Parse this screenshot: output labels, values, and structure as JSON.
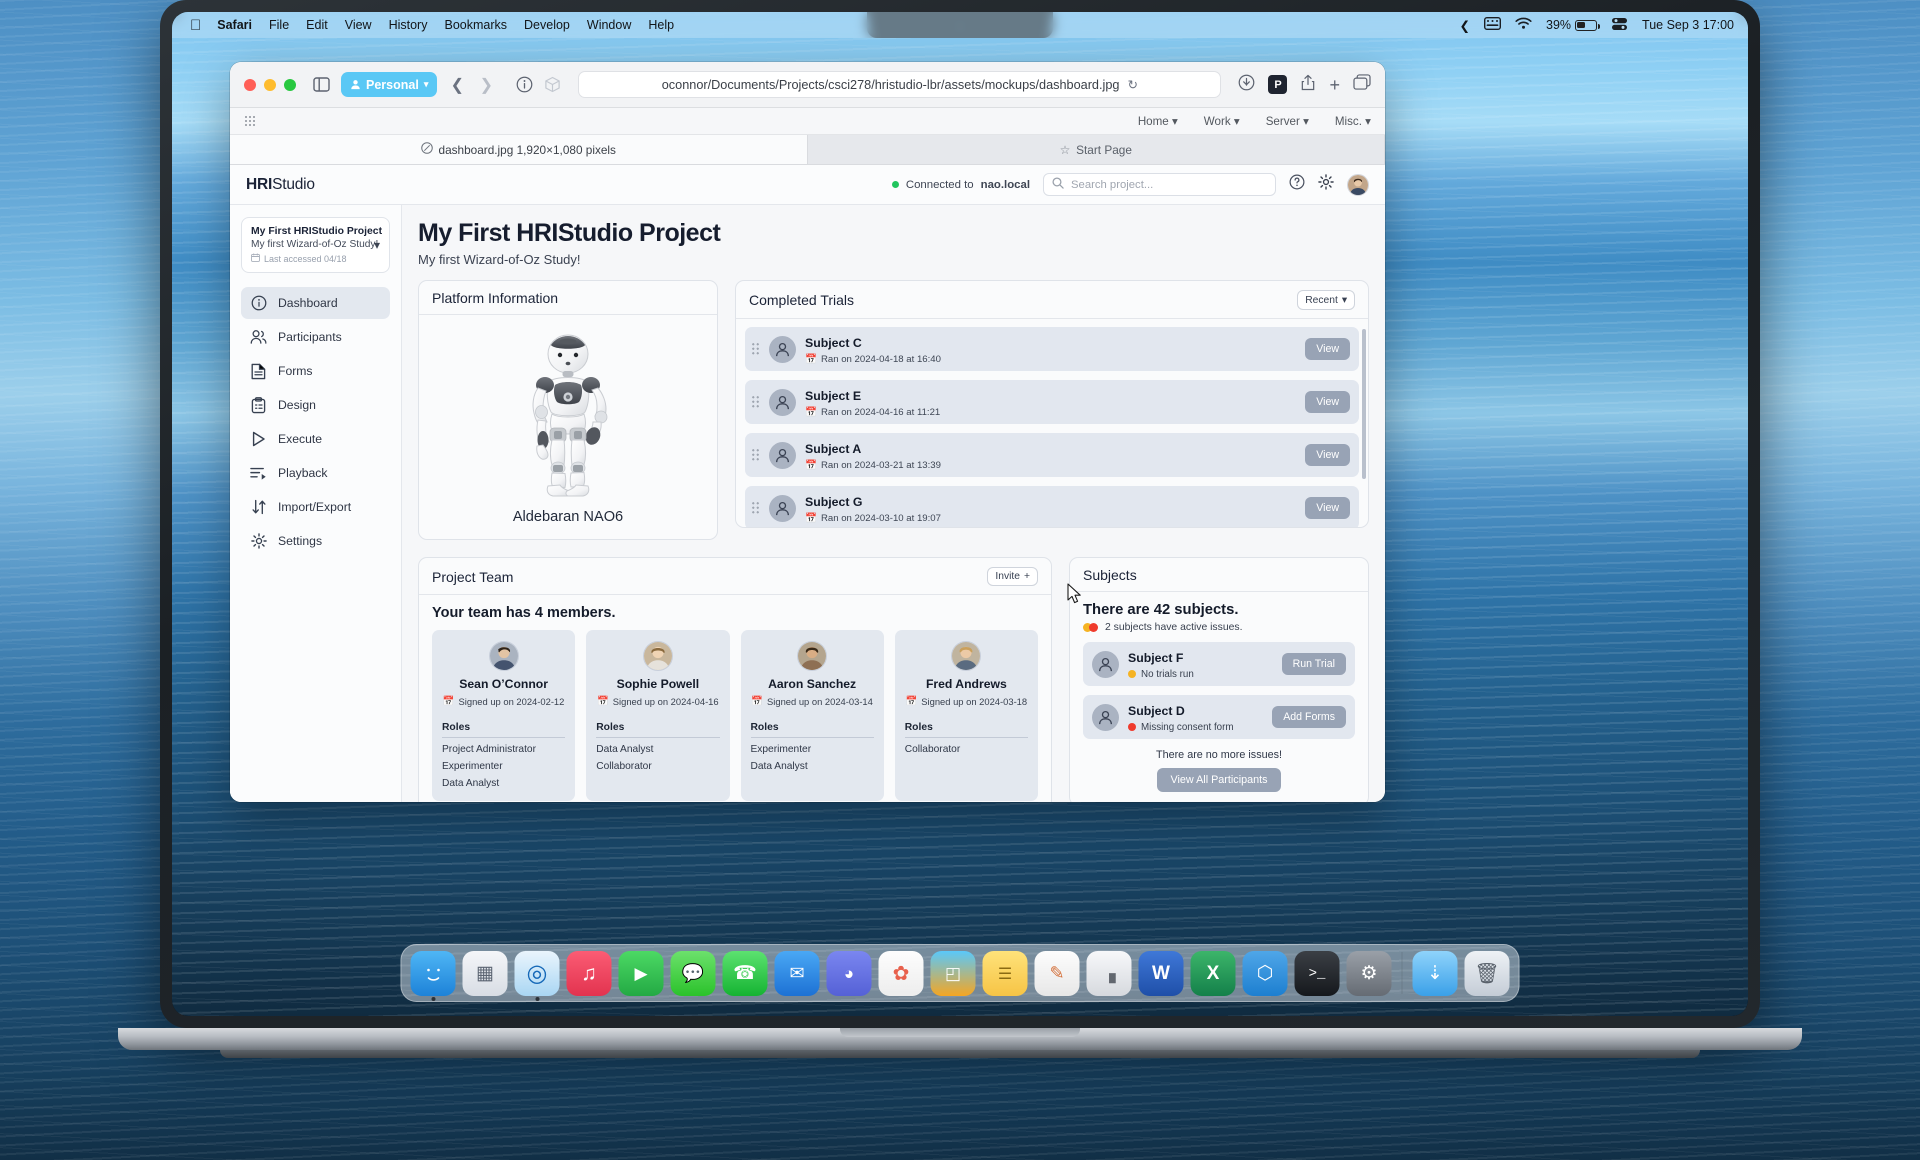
{
  "menubar": {
    "apple_icon": "apple-icon",
    "items": [
      "Safari",
      "File",
      "Edit",
      "View",
      "History",
      "Bookmarks",
      "Develop",
      "Window",
      "Help"
    ],
    "control_center_icon": "control-center-icon",
    "wifi_icon": "wifi-icon",
    "battery_percent": "39%",
    "datetime": "Tue Sep 3  17:00",
    "collapse_icon": "chevron-left-icon"
  },
  "safari": {
    "profile_label": "Personal",
    "url": "oconnor/Documents/Projects/csci278/hristudio-lbr/assets/mockups/dashboard.jpg",
    "reload_icon": "reload-icon",
    "download_icon": "download-icon",
    "profile_badge": "P",
    "share_icon": "share-icon",
    "newtab_icon": "plus-icon",
    "tabs_icon": "tab-overview-icon",
    "sidebar_icon": "sidebar-icon",
    "back_icon": "chevron-left-icon",
    "forward_icon": "chevron-right-icon",
    "info_icon": "info-icon",
    "extensions_icon": "extensions-icon",
    "favorites": [
      "Home",
      "Work",
      "Server",
      "Misc."
    ],
    "tab_active_title": "dashboard.jpg 1,920×1,080 pixels",
    "tab_inactive_title": "Start Page"
  },
  "app": {
    "brand_bold": "HRI",
    "brand_rest": "Studio",
    "connection_prefix": "Connected to ",
    "connection_host": "nao.local",
    "search_placeholder": "Search project...",
    "help_icon": "help-circle-icon",
    "settings_icon": "gear-icon",
    "avatar_icon": "user-avatar"
  },
  "sidebar": {
    "project_name": "My First HRIStudio Project",
    "project_desc": "My first Wizard-of-Oz Study!",
    "project_meta": "Last accessed 04/18",
    "items": [
      {
        "label": "Dashboard",
        "icon": "info-circle-icon",
        "active": true
      },
      {
        "label": "Participants",
        "icon": "users-icon",
        "active": false
      },
      {
        "label": "Forms",
        "icon": "document-icon",
        "active": false
      },
      {
        "label": "Design",
        "icon": "clipboard-icon",
        "active": false
      },
      {
        "label": "Execute",
        "icon": "play-icon",
        "active": false
      },
      {
        "label": "Playback",
        "icon": "playback-icon",
        "active": false
      },
      {
        "label": "Import/Export",
        "icon": "import-export-icon",
        "active": false
      },
      {
        "label": "Settings",
        "icon": "gear-icon",
        "active": false
      }
    ]
  },
  "main": {
    "title": "My First HRIStudio Project",
    "subtitle": "My first Wizard-of-Oz Study!"
  },
  "platform": {
    "header": "Platform Information",
    "robot_name": "Aldebaran NAO6"
  },
  "trials": {
    "header": "Completed Trials",
    "sort_label": "Recent",
    "view_label": "View",
    "rows": [
      {
        "name": "Subject C",
        "meta": "Ran on 2024-04-18 at 16:40"
      },
      {
        "name": "Subject E",
        "meta": "Ran on 2024-04-16 at 11:21"
      },
      {
        "name": "Subject A",
        "meta": "Ran on 2024-03-21 at 13:39"
      },
      {
        "name": "Subject G",
        "meta": "Ran on 2024-03-10 at 19:07"
      }
    ]
  },
  "team": {
    "header": "Project Team",
    "invite_label": "Invite",
    "summary": "Your team has 4 members.",
    "roles_header": "Roles",
    "members": [
      {
        "name": "Sean O’Connor",
        "signed": "Signed up on 2024-02-12",
        "roles": [
          "Project Administrator",
          "Experimenter",
          "Data Analyst"
        ]
      },
      {
        "name": "Sophie Powell",
        "signed": "Signed up on 2024-04-16",
        "roles": [
          "Data Analyst",
          "Collaborator"
        ]
      },
      {
        "name": "Aaron Sanchez",
        "signed": "Signed up on 2024-03-14",
        "roles": [
          "Experimenter",
          "Data Analyst"
        ]
      },
      {
        "name": "Fred Andrews",
        "signed": "Signed up on 2024-03-18",
        "roles": [
          "Collaborator"
        ]
      }
    ]
  },
  "subjects": {
    "header": "Subjects",
    "count_text": "There are 42 subjects.",
    "issues_text": "2 subjects have active issues.",
    "rows": [
      {
        "name": "Subject F",
        "status": "No trials run",
        "status_color": "#f5b323",
        "action": "Run Trial"
      },
      {
        "name": "Subject D",
        "status": "Missing consent form",
        "status_color": "#ef3b2d",
        "action": "Add Forms"
      }
    ],
    "no_more": "There are no more issues!",
    "view_all_label": "View All Participants"
  },
  "dock": {
    "apps": [
      {
        "name": "finder-icon",
        "glyph": "🗂",
        "bg": "linear-gradient(180deg,#4fb6f5,#1d82d8)",
        "running": true
      },
      {
        "name": "launchpad-icon",
        "glyph": "▦",
        "bg": "linear-gradient(180deg,#f2f4f7,#d7dce3)",
        "running": false
      },
      {
        "name": "safari-icon",
        "glyph": "◎",
        "bg": "linear-gradient(180deg,#eaf5fd,#b6dcf6)",
        "running": true
      },
      {
        "name": "music-icon",
        "glyph": "♫",
        "bg": "linear-gradient(180deg,#fb5c74,#e2334f)",
        "running": false
      },
      {
        "name": "facetime-icon",
        "glyph": "▶",
        "bg": "linear-gradient(180deg,#4cd964,#28a745)",
        "running": false
      },
      {
        "name": "messages-icon",
        "glyph": "💬",
        "bg": "linear-gradient(180deg,#6ce16c,#2ec52e)",
        "running": false
      },
      {
        "name": "whatsapp-icon",
        "glyph": "✆",
        "bg": "linear-gradient(180deg,#5ce270,#18b835)",
        "running": false
      },
      {
        "name": "mail-icon",
        "glyph": "✉",
        "bg": "linear-gradient(180deg,#4aa8f5,#1d71d4)",
        "running": false
      },
      {
        "name": "discord-icon",
        "glyph": "◑",
        "bg": "linear-gradient(180deg,#7a86f0,#5561d6)",
        "running": false
      },
      {
        "name": "photos-icon",
        "glyph": "✿",
        "bg": "linear-gradient(180deg,#fdfdfd,#ececec)",
        "running": false
      },
      {
        "name": "keynote-icon",
        "glyph": "◰",
        "bg": "linear-gradient(180deg,#5ac8fa,#f5a623)",
        "running": false
      },
      {
        "name": "notes-icon",
        "glyph": "☰",
        "bg": "linear-gradient(180deg,#ffe27a,#f7c948)",
        "running": false
      },
      {
        "name": "markup-icon",
        "glyph": "✎",
        "bg": "linear-gradient(180deg,#fdfdfd,#e6e6e6)",
        "running": false
      },
      {
        "name": "calculator-icon",
        "glyph": "⌗",
        "bg": "linear-gradient(180deg,#f6f7f9,#d8dade)",
        "running": false
      },
      {
        "name": "word-icon",
        "glyph": "W",
        "bg": "linear-gradient(180deg,#3f78d8,#1f4fa8)",
        "running": false
      },
      {
        "name": "excel-icon",
        "glyph": "X",
        "bg": "linear-gradient(180deg,#3cb56a,#14804a)",
        "running": false
      },
      {
        "name": "vscode-icon",
        "glyph": "⬡",
        "bg": "linear-gradient(180deg,#4fa6e8,#1d7fd0)",
        "running": false
      },
      {
        "name": "terminal-icon",
        "glyph": "⌫",
        "bg": "linear-gradient(180deg,#3b3f45,#15181c)",
        "running": false
      },
      {
        "name": "system-settings-icon",
        "glyph": "⚙",
        "bg": "linear-gradient(180deg,#9aa0a8,#656b73)",
        "running": false
      },
      {
        "name": "downloads-stack-icon",
        "glyph": "⤓",
        "bg": "linear-gradient(180deg,#8fd3fb,#3aa0e8)",
        "running": false
      },
      {
        "name": "trash-icon",
        "glyph": "🗑",
        "bg": "linear-gradient(180deg,#e9eef3,#c6ced7)",
        "running": false
      }
    ]
  }
}
